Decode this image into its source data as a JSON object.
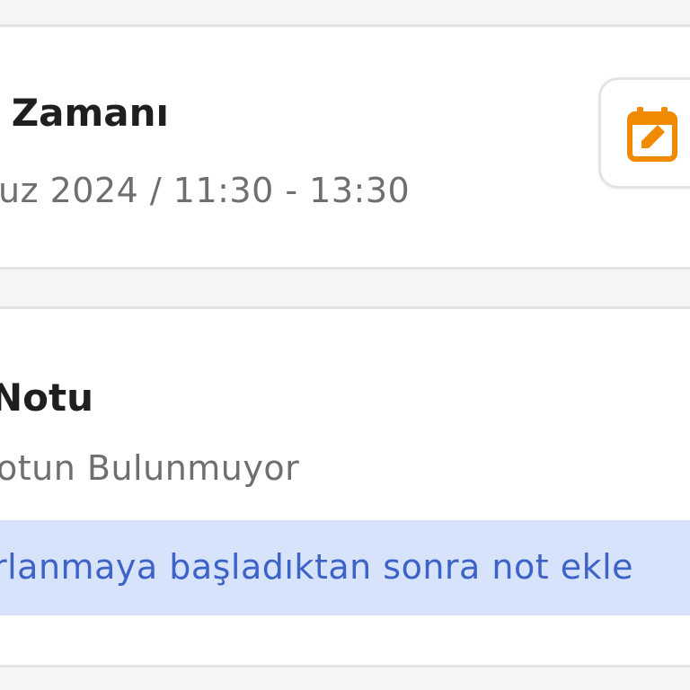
{
  "schedule_card": {
    "title": "t Zamanı",
    "datetime": "uz 2024 / 11:30 - 13:30",
    "edit_icon": "calendar-edit-icon",
    "accent_color": "#f08a00"
  },
  "note_card": {
    "title": "Notu",
    "empty_text": "otun Bulunmuyor",
    "info_text": "rlanmaya başladıktan sonra not ekle",
    "info_bg": "#d7e2fb",
    "info_color": "#3d62c8"
  }
}
